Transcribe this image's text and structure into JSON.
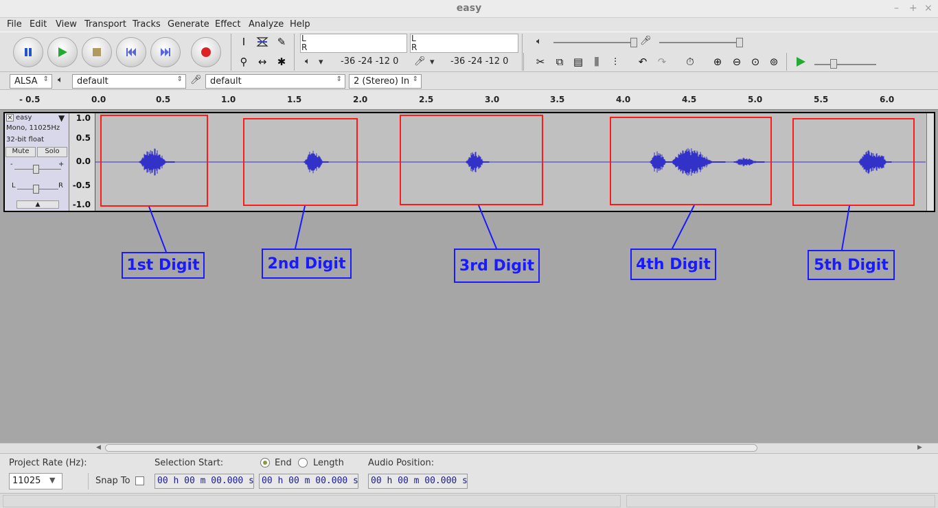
{
  "window": {
    "title": "easy",
    "min": "–",
    "max": "+",
    "close": "×"
  },
  "menu": [
    "File",
    "Edit",
    "View",
    "Transport",
    "Tracks",
    "Generate",
    "Effect",
    "Analyze",
    "Help"
  ],
  "transport": {
    "pause": "pause-icon",
    "play": "play-icon",
    "stop": "stop-icon",
    "skip_start": "skip-start-icon",
    "skip_end": "skip-end-icon",
    "record": "record-icon"
  },
  "meters": {
    "play_lr": [
      "L",
      "R"
    ],
    "rec_lr": [
      "L",
      "R"
    ],
    "play_ticks": "-36 -24 -12  0",
    "rec_ticks": "-36 -24 -12  0"
  },
  "device": {
    "host": "ALSA",
    "playback": "default",
    "recording": "default",
    "channels": "2 (Stereo) In"
  },
  "ruler": [
    "- 0.5",
    "0.0",
    "0.5",
    "1.0",
    "1.5",
    "2.0",
    "2.5",
    "3.0",
    "3.5",
    "4.0",
    "4.5",
    "5.0",
    "5.5",
    "6.0"
  ],
  "track": {
    "name": "easy",
    "info1": "Mono, 11025Hz",
    "info2": "32-bit float",
    "mute": "Mute",
    "solo": "Solo",
    "gain_minus": "-",
    "gain_plus": "+",
    "pan_l": "L",
    "pan_r": "R"
  },
  "scale": [
    "1.0",
    "0.5",
    "0.0",
    "-0.5",
    "-1.0"
  ],
  "annotations": [
    "1st Digit",
    "2nd Digit",
    "3rd Digit",
    "4th Digit",
    "5th Digit"
  ],
  "selection": {
    "project_rate_label": "Project Rate (Hz):",
    "project_rate": "11025",
    "snap_to": "Snap To",
    "selection_start_label": "Selection Start:",
    "end_label": "End",
    "length_label": "Length",
    "audio_position_label": "Audio Position:",
    "start_time": "00 h 00 m 00.000 s",
    "end_time": "00 h 00 m 00.000 s",
    "audio_time": "00 h 00 m 00.000 s"
  },
  "colors": {
    "wave": "#3232c8",
    "annotation": "#1a1aff",
    "box": "#ff1a1a"
  }
}
